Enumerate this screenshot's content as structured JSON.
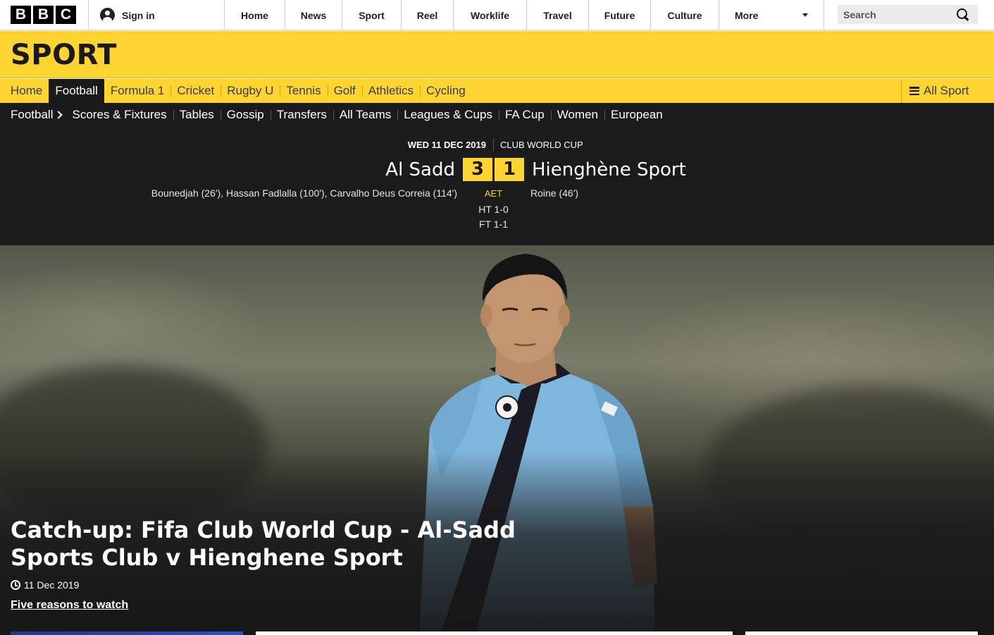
{
  "topbar": {
    "logo_letters": [
      "B",
      "B",
      "C"
    ],
    "signin_label": "Sign in",
    "nav": [
      "Home",
      "News",
      "Sport",
      "Reel",
      "Worklife",
      "Travel",
      "Future",
      "Culture"
    ],
    "more_label": "More",
    "search_placeholder": "Search"
  },
  "sport": {
    "title": "SPORT",
    "primary_nav": [
      "Home",
      "Football",
      "Formula 1",
      "Cricket",
      "Rugby U",
      "Tennis",
      "Golf",
      "Athletics",
      "Cycling"
    ],
    "active_index": 1,
    "all_sport_label": "All Sport"
  },
  "football": {
    "breadcrumb": "Football",
    "secondary_nav": [
      "Scores & Fixtures",
      "Tables",
      "Gossip",
      "Transfers",
      "All Teams",
      "Leagues & Cups",
      "FA Cup",
      "Women",
      "European"
    ]
  },
  "match": {
    "date": "WED 11 DEC 2019",
    "competition": "CLUB WORLD CUP",
    "home_team": "Al Sadd",
    "away_team": "Hienghène Sport",
    "home_score": "3",
    "away_score": "1",
    "home_scorers": "Bounedjah (26'), Hassan Fadlalla (100'), Carvalho Deus Correia (114')",
    "away_scorers": "Roine (46')",
    "status": "AET",
    "half_time": "HT 1-0",
    "full_time": "FT 1-1"
  },
  "hero": {
    "title": "Catch-up: Fifa Club World Cup - Al-Sadd Sports Club v Hienghene Sport",
    "date": "11 Dec 2019",
    "link": "Five reasons to watch"
  },
  "colors": {
    "sport_yellow": "#fed430",
    "dark": "#1b1b1b",
    "jersey_blue": "#7fb6dc"
  }
}
